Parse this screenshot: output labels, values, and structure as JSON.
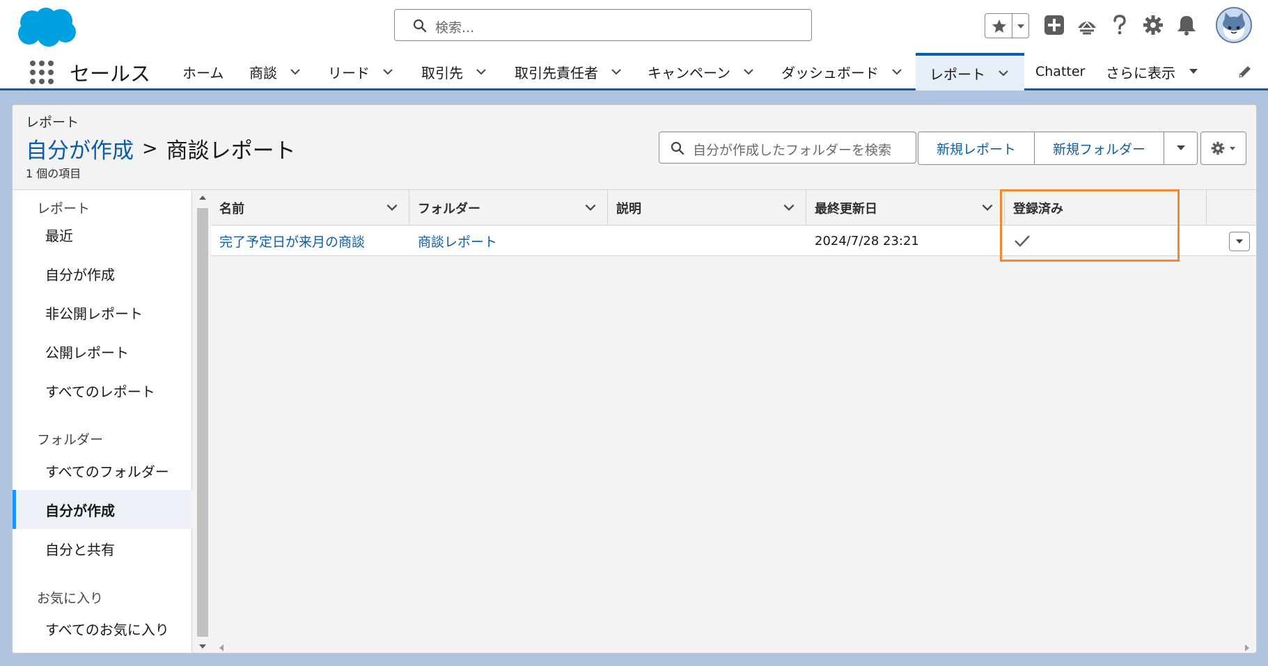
{
  "header": {
    "search_placeholder": "検索...",
    "app_name": "セールス"
  },
  "nav": {
    "items": [
      {
        "label": "ホーム"
      },
      {
        "label": "商談"
      },
      {
        "label": "リード"
      },
      {
        "label": "取引先"
      },
      {
        "label": "取引先責任者"
      },
      {
        "label": "キャンペーン"
      },
      {
        "label": "ダッシュボード"
      },
      {
        "label": "レポート"
      },
      {
        "label": "Chatter"
      },
      {
        "label": "さらに表示"
      }
    ],
    "active_item": "レポート"
  },
  "page": {
    "object_label": "レポート",
    "breadcrumb_link": "自分が作成",
    "breadcrumb_separator": ">",
    "title": "商談レポート",
    "item_count": "1 個の項目",
    "folder_search_placeholder": "自分が作成したフォルダーを検索",
    "new_report_label": "新規レポート",
    "new_folder_label": "新規フォルダー"
  },
  "sidebar": {
    "reports_heading": "レポート",
    "report_items": [
      {
        "label": "最近"
      },
      {
        "label": "自分が作成"
      },
      {
        "label": "非公開レポート"
      },
      {
        "label": "公開レポート"
      },
      {
        "label": "すべてのレポート"
      }
    ],
    "folders_heading": "フォルダー",
    "folder_items": [
      {
        "label": "すべてのフォルダー"
      },
      {
        "label": "自分が作成"
      },
      {
        "label": "自分と共有"
      }
    ],
    "selected_folder": "自分が作成",
    "favorites_heading": "お気に入り",
    "favorite_items": [
      {
        "label": "すべてのお気に入り"
      }
    ]
  },
  "table": {
    "columns": [
      {
        "label": "名前"
      },
      {
        "label": "フォルダー"
      },
      {
        "label": "説明"
      },
      {
        "label": "最終更新日"
      },
      {
        "label": "登録済み"
      }
    ],
    "rows": [
      {
        "name": "完了予定日が来月の商談",
        "folder": "商談レポート",
        "description": "",
        "last_modified": "2024/7/28 23:21",
        "subscribed": true
      }
    ]
  },
  "colors": {
    "brand_blue": "#0b5cab",
    "highlight_orange": "#f08a2c",
    "selected_accent": "#1b96ff"
  },
  "icons": [
    "salesforce-cloud-logo",
    "search-icon",
    "star-icon",
    "chevron-down-icon",
    "plus-icon",
    "trailhead-icon",
    "help-icon",
    "gear-icon",
    "bell-icon",
    "avatar",
    "app-launcher-icon",
    "pencil-icon",
    "check-icon",
    "caret-down-icon"
  ]
}
